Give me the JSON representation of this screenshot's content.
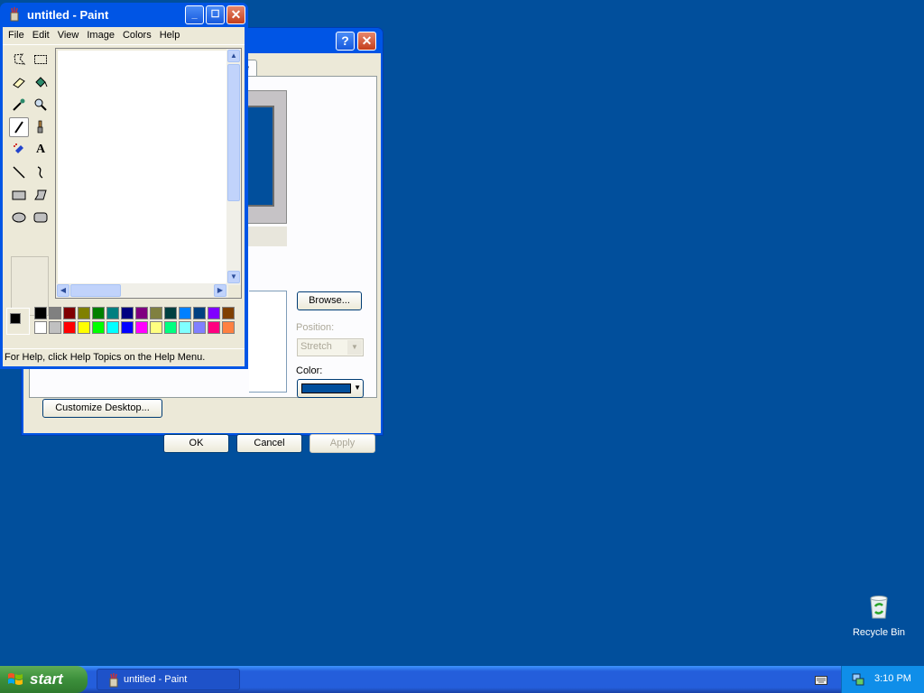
{
  "paint": {
    "title": "untitled - Paint",
    "menu": [
      "File",
      "Edit",
      "View",
      "Image",
      "Colors",
      "Help"
    ],
    "status": "For Help, click Help Topics on the Help Menu.",
    "palette_top": [
      "#000000",
      "#808080",
      "#800000",
      "#808000",
      "#008000",
      "#008080",
      "#000080",
      "#800080",
      "#808040",
      "#004040",
      "#0080ff",
      "#004080",
      "#8000ff",
      "#804000"
    ],
    "palette_bottom": [
      "#ffffff",
      "#c0c0c0",
      "#ff0000",
      "#ffff00",
      "#00ff00",
      "#00ffff",
      "#0000ff",
      "#ff00ff",
      "#ffff80",
      "#00ff80",
      "#80ffff",
      "#8080ff",
      "#ff0080",
      "#ff8040"
    ],
    "foreground_color": "#000000",
    "background_color": "#ffffff"
  },
  "display_dialog": {
    "tab_partial": "e",
    "browse_label": "Browse...",
    "position_label": "Position:",
    "position_value": "Stretch",
    "color_label": "Color:",
    "color_value": "#014f9c",
    "customize_label": "Customize Desktop...",
    "ok_label": "OK",
    "cancel_label": "Cancel",
    "apply_label": "Apply"
  },
  "desktop": {
    "recycle_bin_label": "Recycle Bin",
    "background_color": "#014f9c"
  },
  "taskbar": {
    "start_label": "start",
    "task_label": "untitled - Paint",
    "clock": "3:10 PM"
  }
}
